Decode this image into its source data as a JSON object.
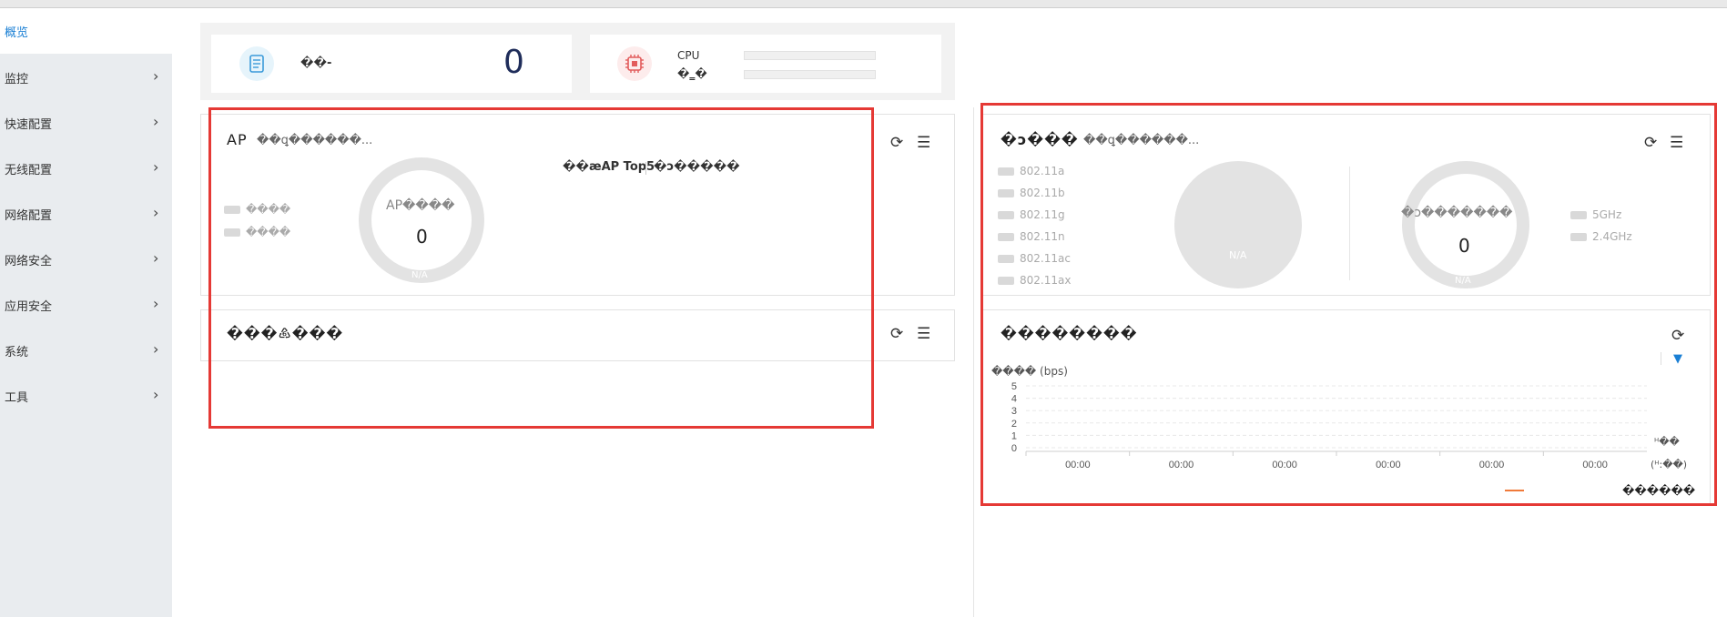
{
  "sidebar": {
    "items": [
      {
        "label": "概览"
      },
      {
        "label": "监控"
      },
      {
        "label": "快速配置"
      },
      {
        "label": "无线配置"
      },
      {
        "label": "网络配置"
      },
      {
        "label": "网络安全"
      },
      {
        "label": "应用安全"
      },
      {
        "label": "系统"
      },
      {
        "label": "工具"
      }
    ],
    "chevron": "›"
  },
  "stats": {
    "left": {
      "icon": "document-icon",
      "label": "��-",
      "value": "0"
    },
    "right": {
      "icon": "cpu-chip-icon",
      "cpu_label": "CPU",
      "mem_label": "�‗�",
      "cpu_percent": 0,
      "mem_percent": 0
    }
  },
  "ap_panel": {
    "title": "AP",
    "subtitle": "��ꝗ������...",
    "legend": [
      "����",
      "����"
    ],
    "donut_label": "AP����",
    "donut_value": "0",
    "donut_na": "N/A",
    "top5_label": "��æAP Top5",
    "top5_alt": "�ↄ�����"
  },
  "client_panel": {
    "title": "�ↄ���",
    "subtitle": "��ꝗ������...",
    "protocols": [
      "802.11a",
      "802.11b",
      "802.11g",
      "802.11n",
      "802.11ac",
      "802.11ax"
    ],
    "pie_na": "N/A",
    "donut_label": "�ↄ�������",
    "donut_value": "0",
    "donut_na": "N/A",
    "bands": [
      "5GHz",
      "2.4GHz"
    ]
  },
  "lower_left_panel": {
    "title": "���♸���"
  },
  "traffic_panel": {
    "title": "��������",
    "unit_label": "���� (bps)",
    "time_unit": "(ᴴ:��)",
    "right_label": "ᴴ��",
    "legend_label": "������",
    "legend_color": "#f07a3a"
  },
  "chart_data": {
    "type": "line",
    "categories": [
      "00:00",
      "00:00",
      "00:00",
      "00:00",
      "00:00",
      "00:00"
    ],
    "series": [
      {
        "values": [
          0,
          0,
          0,
          0,
          0,
          0
        ]
      }
    ],
    "ylabel": "���� (bps)",
    "xlabel": "(ᴴ:��)",
    "ylim": [
      0,
      5
    ],
    "yticks": [
      "0",
      "1",
      "2",
      "3",
      "4",
      "5"
    ],
    "grid": true
  },
  "icons": {
    "refresh": "⟳",
    "list": "☰",
    "filter": "▼"
  },
  "colors": {
    "accent": "#1a7fd4",
    "highlight_box": "#e53935",
    "series_line": "#f07a3a"
  }
}
